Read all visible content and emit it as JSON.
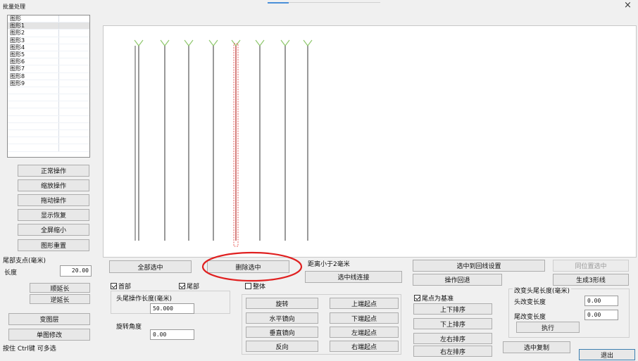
{
  "window": {
    "title": "批量处理",
    "close_symbol": "×"
  },
  "list": {
    "items": [
      "图形",
      "图形1",
      "图形2",
      "图形3",
      "图形4",
      "图形5",
      "图形6",
      "图形7",
      "图形8",
      "图形9"
    ],
    "selected_index": 1
  },
  "left_buttons": {
    "normal": "正常操作",
    "scale": "缩放操作",
    "drag": "拖动操作",
    "display_restore": "显示恢复",
    "fit_all": "全屏缩小",
    "redraw": "图形重置"
  },
  "tail_point": {
    "title": "尾部支点(毫米)",
    "length_label": "长度",
    "length_value": "20.00"
  },
  "extend": {
    "forward": "顺延长",
    "reverse": "逆延长"
  },
  "layer": {
    "change_layer": "变图层",
    "single_edit": "单图修改"
  },
  "status_hint": "按住 Ctrl键 可多选",
  "mid": {
    "select_all": "全部选中",
    "delete_selected": "删除选中",
    "head_check": "首部",
    "tail_check": "尾部",
    "whole_check": "整体",
    "head_tail_len_label": "头尾操作长度(毫米)",
    "head_tail_len_value": "50.000",
    "rotate_angle_label": "旋转角度",
    "rotate_angle_value": "0.00",
    "rotate": "旋转",
    "h_mirror": "水平镜向",
    "v_mirror": "垂直镜向",
    "reverse": "反向",
    "top_start": "上端起点",
    "bottom_start": "下端起点",
    "left_start": "左端起点",
    "right_start": "右端起点",
    "distance_label": "距离小于2毫米",
    "connect_selected": "选中线连接"
  },
  "right": {
    "to_loop_settings": "选中到回线设置",
    "same_position_select": "同位置选中",
    "operation_back": "操作回退",
    "generate_3_lines": "生成3形线",
    "tail_as_base": "尾点为基准",
    "sort_up_down": "上下排序",
    "sort_down_up": "下上排序",
    "sort_left_right": "左右排序",
    "sort_right_left": "右左排序",
    "change_len_title": "改变头尾长度(毫米)",
    "head_change_label": "头改变长度",
    "head_change_value": "0.00",
    "tail_change_label": "尾改变长度",
    "tail_change_value": "0.00",
    "execute": "执行",
    "copy_selected": "选中复制",
    "exit": "退出"
  },
  "colors": {
    "line": "#6e6e6e",
    "branch": "#8ec76b",
    "selection_red": "#e53935",
    "annotation_red": "#e02020"
  }
}
